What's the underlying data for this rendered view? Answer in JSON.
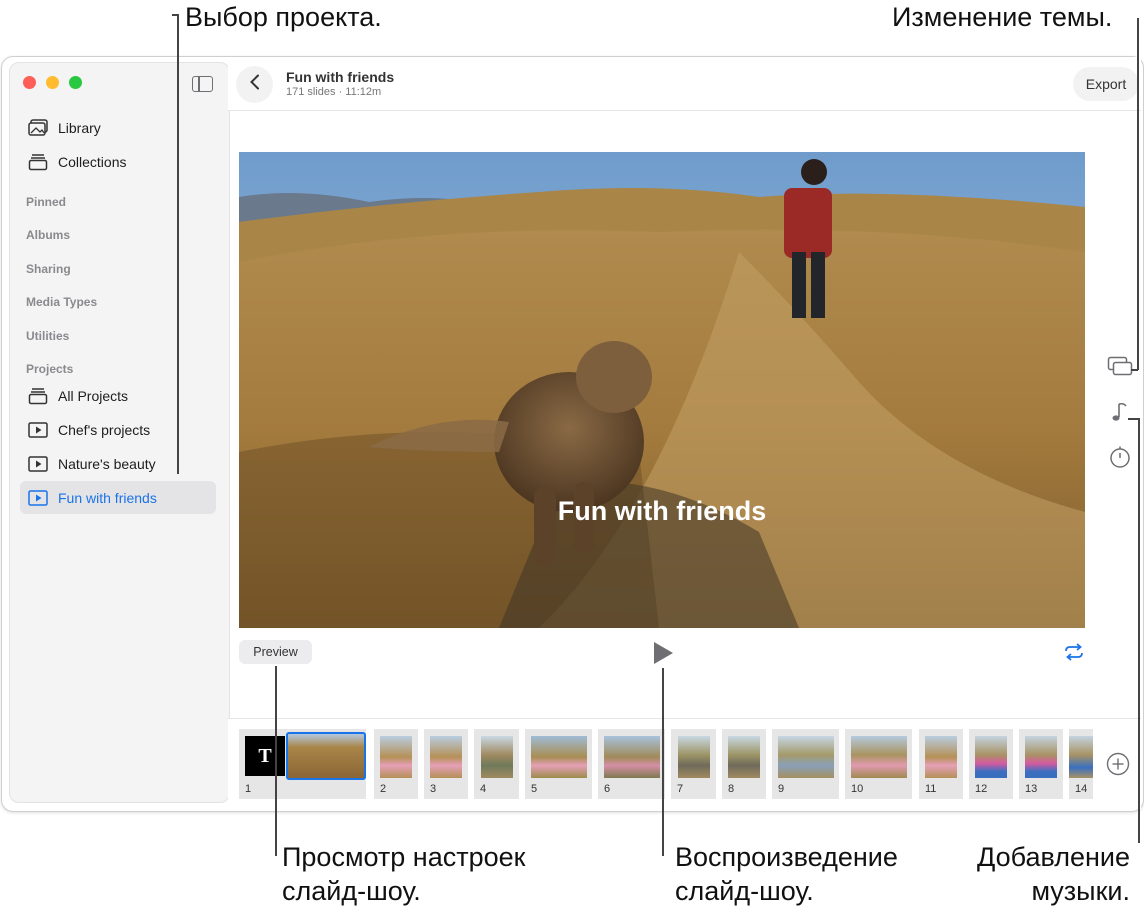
{
  "callouts": {
    "project_select": "Выбор проекта.",
    "theme_change": "Изменение темы.",
    "preview_settings_1": "Просмотр настроек",
    "preview_settings_2": "слайд-шоу.",
    "playback_1": "Воспроизведение",
    "playback_2": "слайд-шоу.",
    "music_1": "Добавление",
    "music_2": "музыки."
  },
  "sidebar": {
    "top_items": [
      {
        "label": "Library",
        "icon": "photo-library-icon"
      },
      {
        "label": "Collections",
        "icon": "collections-icon"
      }
    ],
    "sections": [
      "Pinned",
      "Albums",
      "Sharing",
      "Media Types",
      "Utilities",
      "Projects"
    ],
    "projects": [
      {
        "label": "All Projects",
        "icon": "stack-icon"
      },
      {
        "label": "Chef's projects",
        "icon": "play-box-icon"
      },
      {
        "label": "Nature's beauty",
        "icon": "play-box-icon"
      },
      {
        "label": "Fun with friends",
        "icon": "play-box-icon",
        "selected": true
      }
    ]
  },
  "header": {
    "title": "Fun with friends",
    "subtitle": "171 slides · 11:12m",
    "export_label": "Export"
  },
  "viewer": {
    "overlay_title": "Fun with friends",
    "preview_label": "Preview"
  },
  "filmstrip": {
    "title_card_letter": "T",
    "slides": [
      "1",
      "2",
      "3",
      "4",
      "5",
      "6",
      "7",
      "8",
      "9",
      "10",
      "11",
      "12",
      "13",
      "14"
    ]
  },
  "colors": {
    "accent": "#1a73e8",
    "close": "#fe5f57",
    "minimize": "#febc2e",
    "zoom": "#28c840"
  }
}
